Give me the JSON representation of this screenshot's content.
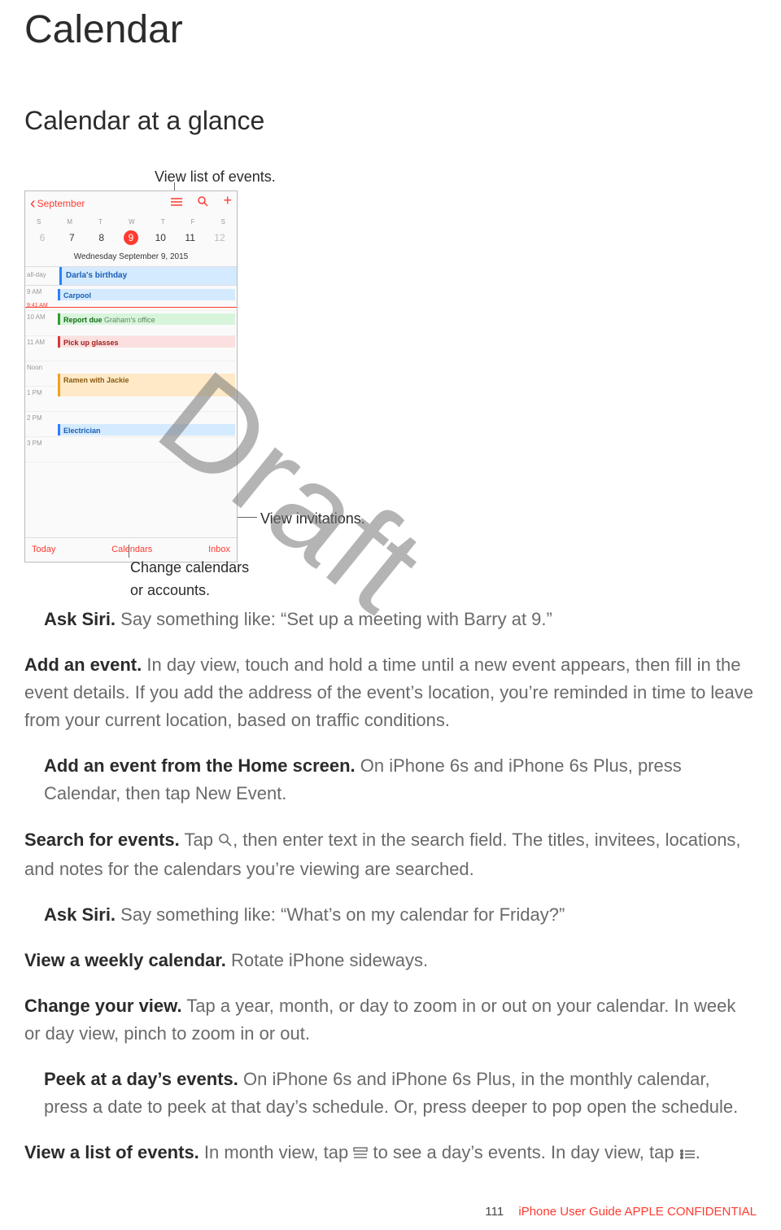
{
  "title": "Calendar",
  "subtitle": "Calendar at a glance",
  "watermark": "Draft",
  "callouts": {
    "top": "View list of events.",
    "right": "View invitations.",
    "bottom1": "Change calendars",
    "bottom2": "or accounts."
  },
  "phone": {
    "back": "September",
    "weekdays": [
      "S",
      "M",
      "T",
      "W",
      "T",
      "F",
      "S"
    ],
    "days": [
      "6",
      "7",
      "8",
      "9",
      "10",
      "11",
      "12"
    ],
    "today_index": 3,
    "date_line": "Wednesday  September 9, 2015",
    "allday_label": "all-day",
    "allday_event": "Darla's birthday",
    "now_time": "9:41 AM",
    "hours": [
      "9 AM",
      "10 AM",
      "11 AM",
      "Noon",
      "1 PM",
      "2 PM",
      "3 PM"
    ],
    "events": {
      "carpool": "Carpool",
      "report": "Report due",
      "report_sub": "Graham's office",
      "pickup": "Pick up glasses",
      "ramen": "Ramen with Jackie",
      "elec": "Electrician"
    },
    "bottom": {
      "today": "Today",
      "calendars": "Calendars",
      "inbox": "Inbox"
    }
  },
  "body": {
    "siri1_label": "Ask Siri.",
    "siri1_text": " Say something like: “Set up a meeting with Barry at 9.”",
    "add_label": "Add an event.",
    "add_text": " In day view, touch and hold a time until a new event appears, then fill in the event details. If you add the address of the event’s location, you’re reminded in time to leave from your current location, based on traffic conditions.",
    "addhome_label": "Add an event from the Home screen.",
    "addhome_text": " On iPhone 6s and iPhone 6s Plus, press Calendar, then tap New Event.",
    "search_label": "Search for events.",
    "search_pre": " Tap ",
    "search_post": ", then enter text in the search field. The titles, invitees, locations, and notes for the calendars you’re viewing are searched.",
    "siri2_label": "Ask Siri.",
    "siri2_text": " Say something like: “What’s on my calendar for Friday?”",
    "weekly_label": "View a weekly calendar.",
    "weekly_text": " Rotate iPhone sideways.",
    "change_label": "Change your view.",
    "change_text": " Tap a year, month, or day to zoom in or out on your calendar. In week or day view, pinch to zoom in or out.",
    "peek_label": "Peek at a day’s events.",
    "peek_text": " On iPhone 6s and iPhone 6s Plus, in the monthly calendar, press a date to peek at that day’s schedule. Or, press deeper to pop open the schedule.",
    "list_label": "View a list of events.",
    "list_pre": " In month view, tap ",
    "list_mid": " to see a day’s events. In day view, tap ",
    "list_post": "."
  },
  "footer": {
    "page": "111",
    "text": "iPhone User Guide  APPLE CONFIDENTIAL"
  }
}
